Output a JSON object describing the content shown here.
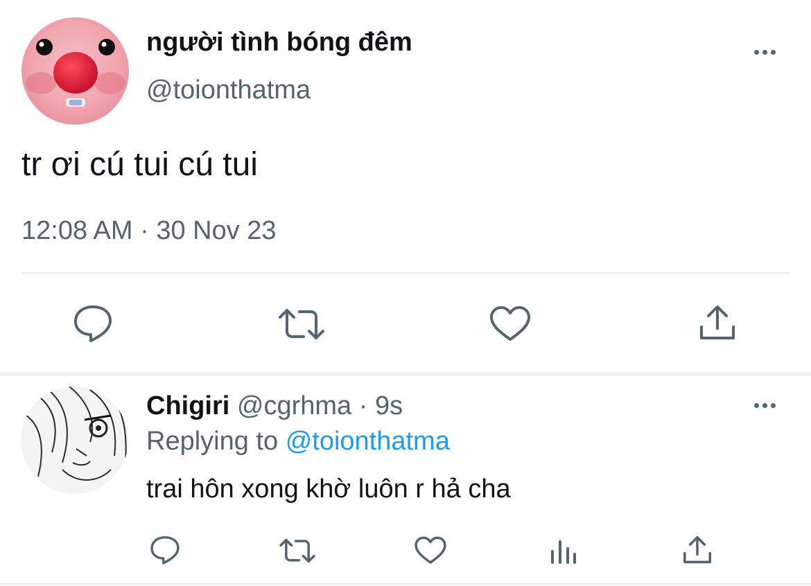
{
  "main_tweet": {
    "display_name": "người tình bóng đêm",
    "handle": "@toionthatma",
    "text": "tr ơi cú tui cú tui",
    "time": "12:08 AM",
    "separator": "·",
    "date": "30 Nov 23",
    "actions": [
      "reply-icon",
      "retweet-icon",
      "like-icon",
      "share-icon"
    ]
  },
  "reply": {
    "display_name": "Chigiri",
    "handle": "@cgrhma",
    "separator": "·",
    "age": "9s",
    "replying_prefix": "Replying to",
    "replying_handle": "@toionthatma",
    "text": "trai hôn xong khờ luôn r hả cha",
    "actions": [
      "reply-icon",
      "retweet-icon",
      "like-icon",
      "analytics-icon",
      "share-icon"
    ]
  },
  "colors": {
    "text": "#0f1419",
    "muted": "#536471",
    "link": "#1d9bf0",
    "divider": "#e6ecf0",
    "avatar_pink": "#f3a4ae",
    "avatar_nose": "#d41f35"
  }
}
